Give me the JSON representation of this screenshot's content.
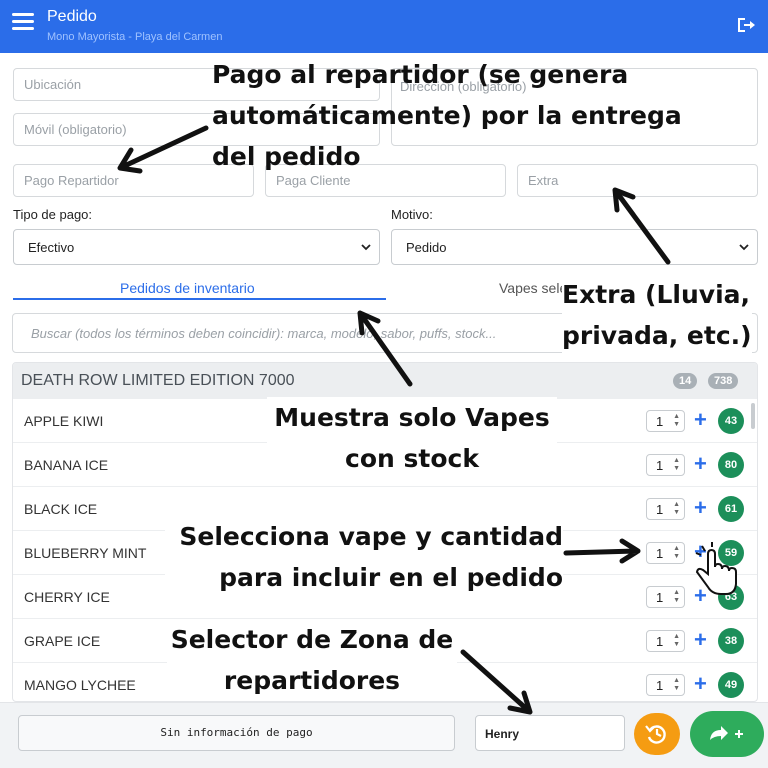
{
  "header": {
    "title": "Pedido",
    "subtitle": "Mono Mayorista - Playa del Carmen",
    "menu_icon": "hamburger-menu-icon",
    "logout_icon": "logout-icon",
    "color": "#2b6de9"
  },
  "form": {
    "location_placeholder": "Ubicación",
    "phone_placeholder": "Móvil (obligatorio)",
    "address_placeholder": "Dirección (obligatorio)",
    "delivery_pay_placeholder": "Pago Repartidor",
    "client_pay_placeholder": "Paga Cliente",
    "extra_placeholder": "Extra",
    "payment_type_label": "Tipo de pago:",
    "payment_type_value": "Efectivo",
    "reason_label": "Motivo:",
    "reason_value": "Pedido"
  },
  "tabs": [
    {
      "label": "Pedidos de inventario",
      "active": true
    },
    {
      "label": "Vapes seleccionados",
      "active": false
    }
  ],
  "search": {
    "placeholder": "Buscar (todos los términos deben coincidir): marca, modelo, sabor, puffs, stock..."
  },
  "inventory": {
    "group_title": "DEATH ROW LIMITED EDITION 7000",
    "group_count": "14",
    "group_stock": "738",
    "items": [
      {
        "name": "APPLE KIWI",
        "qty": "1",
        "stock": "43"
      },
      {
        "name": "BANANA ICE",
        "qty": "1",
        "stock": "80"
      },
      {
        "name": "BLACK ICE",
        "qty": "1",
        "stock": "61"
      },
      {
        "name": "BLUEBERRY MINT",
        "qty": "1",
        "stock": "59"
      },
      {
        "name": "CHERRY ICE",
        "qty": "1",
        "stock": "63"
      },
      {
        "name": "GRAPE ICE",
        "qty": "1",
        "stock": "38"
      },
      {
        "name": "MANGO LYCHEE",
        "qty": "1",
        "stock": "49"
      }
    ]
  },
  "footer": {
    "payment_info": "Sin información de pago",
    "zone_value": "Henry",
    "reset_icon": "history-reset-icon",
    "send_icon": "share-plus-icon"
  },
  "annotations": {
    "delivery_pay": [
      "Pago al repartidor (se genera",
      "automáticamente) por la entrega",
      "del pedido"
    ],
    "extra": [
      "Extra (Lluvia,",
      "privada, etc.)"
    ],
    "stock_only": [
      "Muestra solo Vapes",
      "con stock"
    ],
    "select_vape": [
      "Selecciona vape y cantidad",
      "para incluir en el pedido"
    ],
    "zone_selector": [
      "Selector de Zona de",
      "repartidores"
    ]
  }
}
